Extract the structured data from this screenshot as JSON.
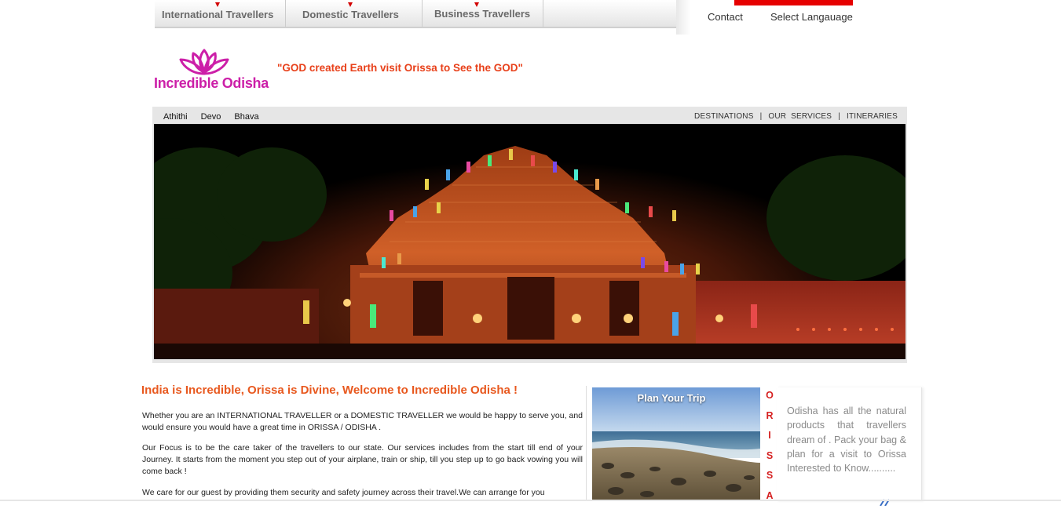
{
  "top_nav": {
    "items": [
      {
        "label": "International Travellers"
      },
      {
        "label": "Domestic Travellers"
      },
      {
        "label": "Business Travellers"
      }
    ],
    "contact_label": "Contact",
    "language_label": "Select Langauage"
  },
  "logo": {
    "text": "Incredible Odisha",
    "icon": "lotus-icon",
    "color": "#cc1fa8"
  },
  "tagline": "\"GOD created Earth visit Orissa to See the GOD\"",
  "header_strip": {
    "left_words": [
      "Athithi",
      "Devo",
      "Bhava"
    ],
    "nav": [
      {
        "label": "DESTINATIONS"
      },
      {
        "label": "OUR  SERVICES"
      },
      {
        "label": "ITINERARIES"
      }
    ],
    "separator": "|"
  },
  "banner": {
    "image": "konark-dance-festival-photo"
  },
  "welcome": {
    "title": "India is Incredible, Orissa is Divine, Welcome to Incredible Odisha !",
    "paragraphs": [
      "Whether you are an INTERNATIONAL TRAVELLER or a DOMESTIC TRAVELLER we would be happy to serve you, and would ensure you would have a great time in ORISSA / ODISHA .",
      "Our Focus is to be the care taker of the travellers to our state. Our services includes from the start till end of your Journey. It starts from the moment you step out of your airplane, train or ship, till you step up to go back vowing you will come back !",
      "We care for our guest by providing them security and safety journey across their travel.We can arrange for you"
    ]
  },
  "plan_trip": {
    "title": "Plan Your Trip",
    "image": "beach-turtles-photo"
  },
  "orissa_letters": [
    "O",
    "R",
    "I",
    "S",
    "S",
    "A"
  ],
  "side_text": "Odisha has all the natural products that travellers dream of . Pack your bag & plan for a visit to Orissa Interested to Know..........",
  "colors": {
    "accent_red": "#e60000",
    "tagline_orange": "#e8401a",
    "title_orange": "#e8581e",
    "logo_pink": "#cc1fa8",
    "orissa_red": "#d52020"
  }
}
